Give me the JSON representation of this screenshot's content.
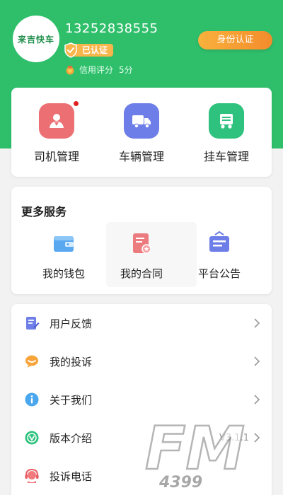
{
  "profile": {
    "avatar_text": "来吉快车",
    "phone": "13252838555",
    "verified_label": "已认证",
    "credit_label": "信用评分",
    "credit_score": "5分",
    "id_button": "身份认证"
  },
  "main_actions": [
    {
      "label": "司机管理",
      "icon": "driver-icon",
      "color": "#ec6f73",
      "has_dot": true
    },
    {
      "label": "车辆管理",
      "icon": "truck-icon",
      "color": "#6e7ee8",
      "has_dot": false
    },
    {
      "label": "挂车管理",
      "icon": "trailer-icon",
      "color": "#2ec27e",
      "has_dot": false
    }
  ],
  "services": {
    "title": "更多服务",
    "items": [
      {
        "label": "我的钱包",
        "icon": "wallet-icon"
      },
      {
        "label": "我的合同",
        "icon": "contract-icon"
      },
      {
        "label": "平台公告",
        "icon": "announcement-icon"
      }
    ]
  },
  "menu": [
    {
      "label": "用户反馈",
      "icon": "feedback-icon",
      "value": ""
    },
    {
      "label": "我的投诉",
      "icon": "complaint-icon",
      "value": ""
    },
    {
      "label": "关于我们",
      "icon": "info-icon",
      "value": ""
    },
    {
      "label": "版本介绍",
      "icon": "version-icon",
      "value": "V3.1.1"
    },
    {
      "label": "投诉电话",
      "icon": "hotline-icon",
      "value": ""
    }
  ],
  "watermark": {
    "line1": "FM",
    "line2": "4399"
  },
  "colors": {
    "brand_green": "#2fbf6b",
    "badge_orange": "#f7b64c",
    "button_orange": "#f48c2c"
  }
}
